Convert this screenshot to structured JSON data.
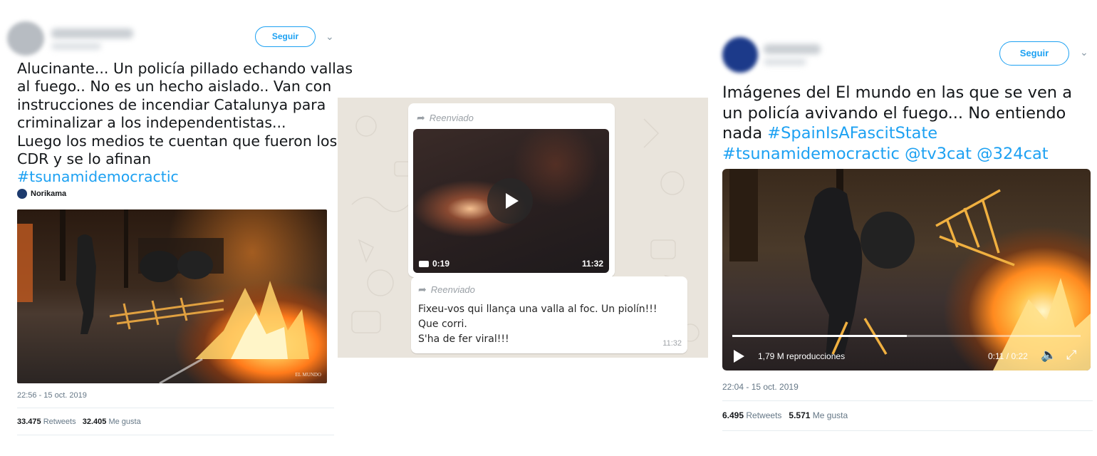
{
  "tweet1": {
    "follow_label": "Seguir",
    "text_lines": [
      "Alucinante... Un policía pillado echando vallas",
      "al fuego.. No es un hecho aislado.. Van con",
      "instrucciones de incendiar Catalunya para",
      "criminalizar a los independentistas...",
      "Luego los medios te cuentan que fueron los",
      "CDR y se lo afinan"
    ],
    "hashtag": "#tsunamidemocractic",
    "media_credit": "Norikama",
    "watermark": "EL MUNDO",
    "timestamp": "22:56 - 15 oct. 2019",
    "retweets_count": "33.475",
    "retweets_label": "Retweets",
    "likes_count": "32.405",
    "likes_label": "Me gusta"
  },
  "whatsapp": {
    "forwarded_label": "Reenviado",
    "video_duration": "0:19",
    "video_time": "11:32",
    "message_lines": [
      "Fixeu-vos qui llança una valla al foc. Un piolín!!!",
      "Que corri.",
      "S'ha de fer viral!!!"
    ],
    "message_time": "11:32"
  },
  "tweet2": {
    "follow_label": "Seguir",
    "text_line1": "Imágenes del El mundo en las que se ven a",
    "text_line2": "un policía avivando el fuego... No entiendo",
    "text_line3_plain": "nada ",
    "hashtag1": "#SpainIsAFascitState",
    "hashtag2": "#tsunamidemocractic",
    "mention1": "@tv3cat",
    "mention2": "@324cat",
    "video_views": "1,79 M reproducciones",
    "video_time": "0:11 / 0:22",
    "video_progress": 0.5,
    "timestamp": "22:04 - 15 oct. 2019",
    "retweets_count": "6.495",
    "retweets_label": "Retweets",
    "likes_count": "5.571",
    "likes_label": "Me gusta"
  }
}
